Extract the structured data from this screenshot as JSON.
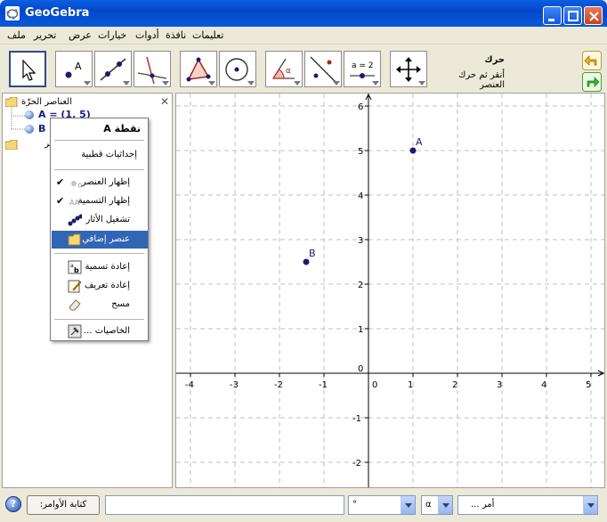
{
  "window": {
    "title": "GeoGebra"
  },
  "menu": {
    "items": [
      "ملف",
      "تحرير",
      "عرض",
      "خيارات",
      "أدوات",
      "نافذة",
      "تعليمات"
    ]
  },
  "toolbar": {
    "active_tool_name": "حرك",
    "active_tool_hint": "أنقر ثم حرك العنصر",
    "slider_tool_label": "a = 2",
    "angle_tool_label": "α",
    "point_tool_label": "A"
  },
  "algebra": {
    "free_objects_label": "العناصر الحرّة",
    "dependent_objects_label": "العناصر التابعة",
    "items": [
      {
        "label": "A = (1, 5)"
      },
      {
        "label": "B"
      }
    ]
  },
  "context_menu": {
    "title": "نقطة A",
    "items": [
      {
        "label": "إحداثيات قطبية",
        "checked": false,
        "highlighted": false
      },
      {
        "label": "إظهار العنصر",
        "checked": true,
        "highlighted": false
      },
      {
        "label": "إظهار التسمية",
        "checked": true,
        "highlighted": false
      },
      {
        "label": "تشغيل الأثار",
        "checked": false,
        "highlighted": false
      },
      {
        "label": "عنصر إضافي",
        "checked": false,
        "highlighted": true
      },
      {
        "label": "إعادة تسمية",
        "checked": false,
        "highlighted": false
      },
      {
        "label": "إعادة تعريف",
        "checked": false,
        "highlighted": false
      },
      {
        "label": "مسح",
        "checked": false,
        "highlighted": false
      },
      {
        "label": "الخاصيات ...",
        "checked": false,
        "highlighted": false
      }
    ]
  },
  "graphics": {
    "x_range": [
      -4,
      5
    ],
    "y_range": [
      -2,
      6
    ],
    "x_ticks": [
      "-4",
      "-3",
      "-2",
      "-1",
      "0",
      "1",
      "2",
      "3",
      "4",
      "5"
    ],
    "y_ticks": [
      "6",
      "5",
      "4",
      "3",
      "2",
      "1",
      "-1",
      "-2"
    ],
    "grid": true,
    "points": [
      {
        "name": "A",
        "x": 1,
        "y": 5
      },
      {
        "name": "B",
        "x": -1.4,
        "y": 2.5
      }
    ],
    "point_color": "#1a1a6e"
  },
  "inputbar": {
    "command_button_label": "كتابة الأوامر:",
    "degree_combo_value": "°",
    "alpha_combo_value": "α",
    "command_combo_value": "أمر ..."
  }
}
